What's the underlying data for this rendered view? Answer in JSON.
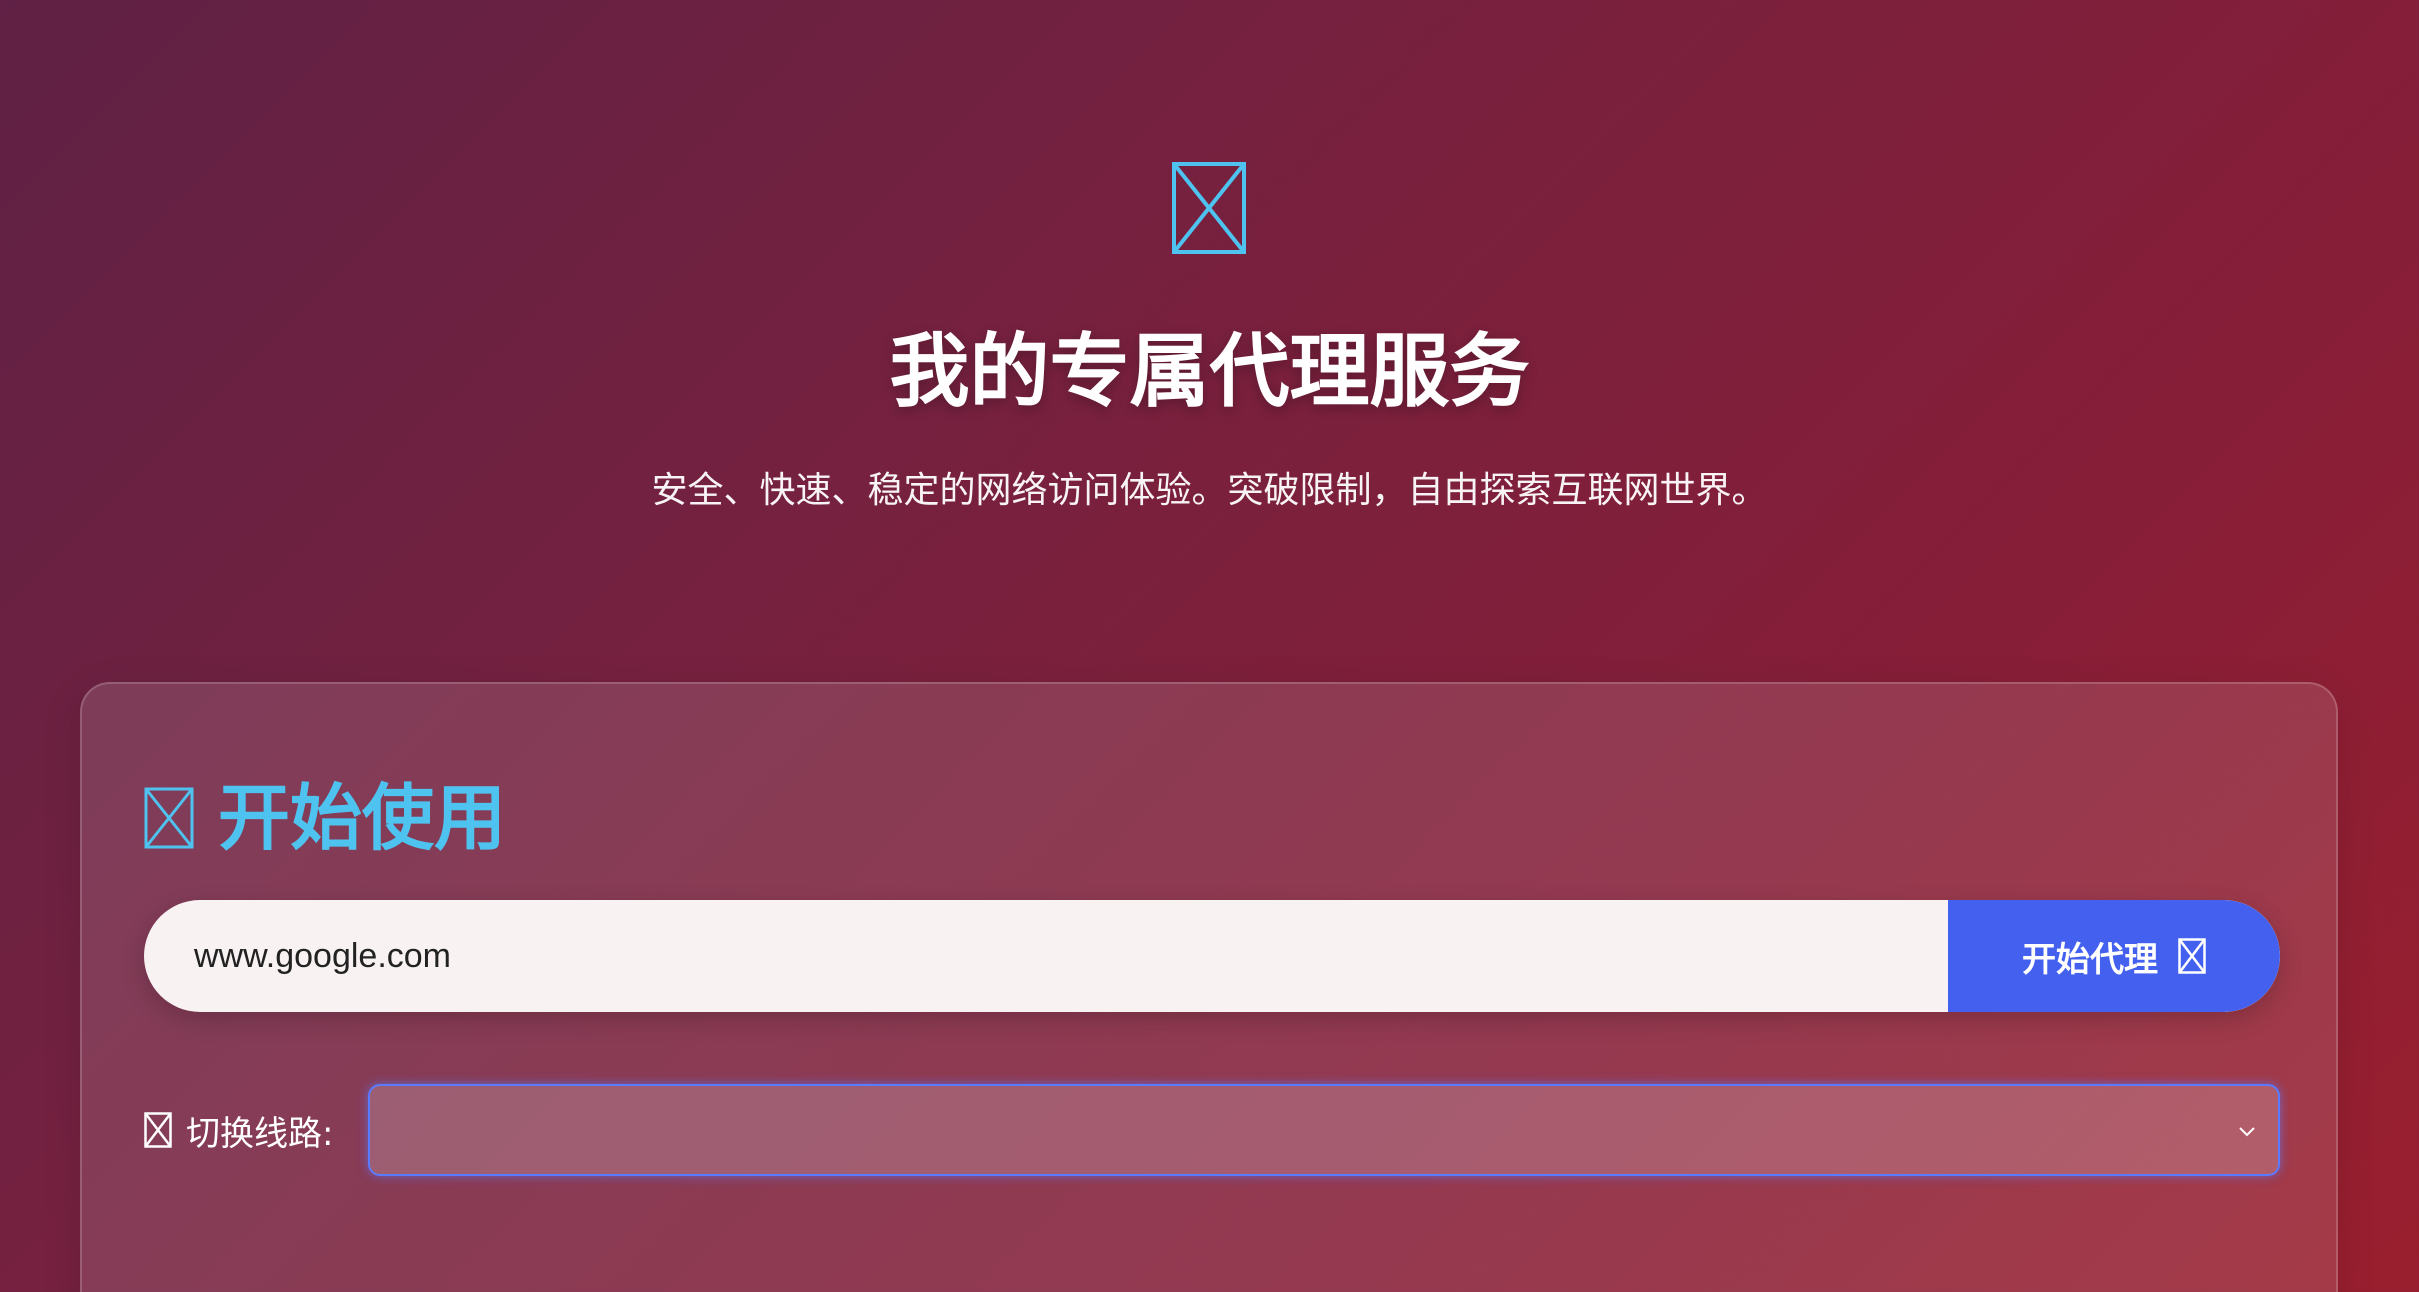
{
  "hero": {
    "title": "我的专属代理服务",
    "subtitle": "安全、快速、稳定的网络访问体验。突破限制，自由探索互联网世界。",
    "icon": "missing-glyph-icon"
  },
  "card": {
    "title": "开始使用",
    "icon": "missing-glyph-icon",
    "url_input": {
      "value": "www.google.com",
      "placeholder": ""
    },
    "proxy_button": {
      "label": "开始代理",
      "icon": "missing-glyph-icon"
    },
    "line_switch": {
      "label": "切换线路:",
      "icon": "missing-glyph-icon",
      "selected": ""
    }
  },
  "colors": {
    "accent": "#4fc3f0",
    "button": "#4361ee",
    "select_border": "#5b7bff"
  }
}
